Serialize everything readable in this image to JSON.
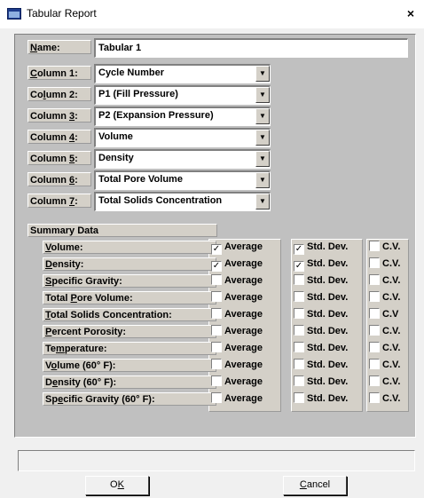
{
  "window": {
    "title": "Tabular Report",
    "close_glyph": "×"
  },
  "name": {
    "label_pre": "",
    "label_u": "N",
    "label_post": "ame:",
    "value": "Tabular 1"
  },
  "columns": [
    {
      "label_pre": "",
      "label_u": "C",
      "label_post": "olumn 1:",
      "value": "Cycle Number"
    },
    {
      "label_pre": "Co",
      "label_u": "l",
      "label_post": "umn 2:",
      "value": "P1 (Fill Pressure)"
    },
    {
      "label_pre": "Column ",
      "label_u": "3",
      "label_post": ":",
      "value": "P2 (Expansion Pressure)"
    },
    {
      "label_pre": "Column ",
      "label_u": "4",
      "label_post": ":",
      "value": "Volume"
    },
    {
      "label_pre": "Column ",
      "label_u": "5",
      "label_post": ":",
      "value": "Density"
    },
    {
      "label_pre": "Column ",
      "label_u": "6",
      "label_post": ":",
      "value": "Total Pore Volume"
    },
    {
      "label_pre": "Column ",
      "label_u": "7",
      "label_post": ":",
      "value": "Total Solids Concentration"
    }
  ],
  "summary": {
    "title": "Summary Data",
    "rows": [
      {
        "label_pre": "",
        "label_u": "V",
        "label_post": "olume:",
        "average": true,
        "std": true,
        "cv": false,
        "cv_label": "C.V."
      },
      {
        "label_pre": "",
        "label_u": "D",
        "label_post": "ensity:",
        "average": true,
        "std": true,
        "cv": false,
        "cv_label": "C.V."
      },
      {
        "label_pre": "",
        "label_u": "S",
        "label_post": "pecific Gravity:",
        "average": false,
        "std": false,
        "cv": false,
        "cv_label": "C.V."
      },
      {
        "label_pre": "Total ",
        "label_u": "P",
        "label_post": "ore Volume:",
        "average": false,
        "std": false,
        "cv": false,
        "cv_label": "C.V."
      },
      {
        "label_pre": "",
        "label_u": "T",
        "label_post": "otal Solids Concentration:",
        "average": false,
        "std": false,
        "cv": false,
        "cv_label": "C.V"
      },
      {
        "label_pre": "",
        "label_u": "P",
        "label_post": "ercent Porosity:",
        "average": false,
        "std": false,
        "cv": false,
        "cv_label": "C.V."
      },
      {
        "label_pre": "Te",
        "label_u": "m",
        "label_post": "perature:",
        "average": false,
        "std": false,
        "cv": false,
        "cv_label": "C.V."
      },
      {
        "label_pre": "V",
        "label_u": "o",
        "label_post": "lume (60° F):",
        "average": false,
        "std": false,
        "cv": false,
        "cv_label": "C.V."
      },
      {
        "label_pre": "D",
        "label_u": "e",
        "label_post": "nsity (60° F):",
        "average": false,
        "std": false,
        "cv": false,
        "cv_label": "C.V."
      },
      {
        "label_pre": "Sp",
        "label_u": "e",
        "label_post": "cific Gravity (60° F):",
        "average": false,
        "std": false,
        "cv": false,
        "cv_label": "C.V."
      }
    ],
    "average_label": "Average",
    "std_label": "Std. Dev."
  },
  "buttons": {
    "ok": {
      "pre": "O",
      "u": "K",
      "post": ""
    },
    "cancel": {
      "pre": "",
      "u": "C",
      "post": "ancel"
    }
  },
  "icons": {
    "window": "report-window-icon",
    "dropdown": "chevron-down-icon",
    "check": "✓",
    "dropdown_glyph": "▼"
  }
}
